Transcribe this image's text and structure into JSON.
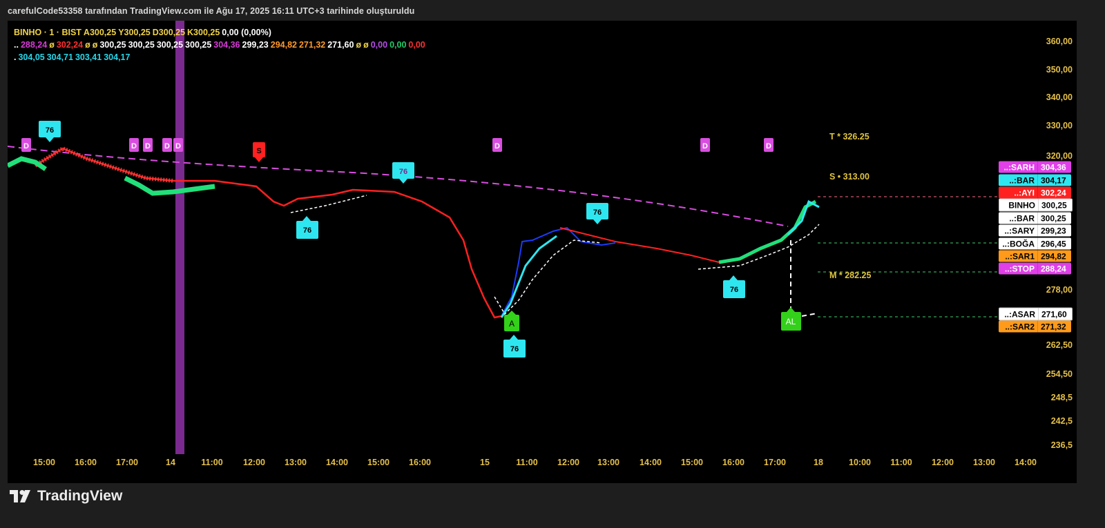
{
  "header": {
    "text": "carefulCode53358 tarafından TradingView.com ile Ağu 17, 2025 16:11 UTC+3 tarihinde oluşturuldu"
  },
  "legend": {
    "row1": [
      {
        "text": "BINHO · 1 · BIST",
        "color": "#f0d349"
      },
      {
        "text": "A300,25",
        "color": "#f0d349"
      },
      {
        "text": "Y300,25",
        "color": "#f0d349"
      },
      {
        "text": "D300,25",
        "color": "#f0d349"
      },
      {
        "text": "K300,25",
        "color": "#f0d349"
      },
      {
        "text": "0,00 (0,00%)",
        "color": "#ffffff"
      }
    ],
    "row2": [
      {
        "text": "..",
        "color": "#ffffff"
      },
      {
        "text": "288,24",
        "color": "#d63bd6"
      },
      {
        "text": "ø",
        "color": "#f0d349"
      },
      {
        "text": "302,24",
        "color": "#ff3030"
      },
      {
        "text": "ø",
        "color": "#f0d349"
      },
      {
        "text": "ø",
        "color": "#f0d349"
      },
      {
        "text": "300,25",
        "color": "#ffffff"
      },
      {
        "text": "300,25",
        "color": "#ffffff"
      },
      {
        "text": "300,25",
        "color": "#ffffff"
      },
      {
        "text": "300,25",
        "color": "#ffffff"
      },
      {
        "text": "304,36",
        "color": "#d63bd6"
      },
      {
        "text": "299,23",
        "color": "#ffffff"
      },
      {
        "text": "294,82",
        "color": "#ff9a2e"
      },
      {
        "text": "271,32",
        "color": "#ff9a2e"
      },
      {
        "text": "271,60",
        "color": "#ffffff"
      },
      {
        "text": "ø",
        "color": "#f0d349"
      },
      {
        "text": "ø",
        "color": "#f0d349"
      },
      {
        "text": "0,00",
        "color": "#b64ee8"
      },
      {
        "text": "0,00",
        "color": "#1fcc6b"
      },
      {
        "text": "0,00",
        "color": "#ff3030"
      }
    ],
    "row3": [
      {
        "text": ".",
        "color": "#ffffff"
      },
      {
        "text": "304,05",
        "color": "#27d6e8"
      },
      {
        "text": "304,71",
        "color": "#27d6e8"
      },
      {
        "text": "303,41",
        "color": "#27d6e8"
      },
      {
        "text": "304,17",
        "color": "#27d6e8"
      }
    ]
  },
  "price_axis": {
    "ticks": [
      "360,00",
      "350,00",
      "340,00",
      "330,00",
      "320,00",
      "278,00",
      "262,50",
      "254,50",
      "248,5",
      "242,5",
      "236,5"
    ]
  },
  "time_axis": {
    "ticks": [
      "15:00",
      "16:00",
      "17:00",
      "14",
      "11:00",
      "12:00",
      "13:00",
      "14:00",
      "15:00",
      "16:00",
      "15",
      "11:00",
      "12:00",
      "13:00",
      "14:00",
      "15:00",
      "16:00",
      "17:00",
      "18",
      "10:00",
      "11:00",
      "12:00",
      "13:00",
      "14:00"
    ]
  },
  "price_badges": [
    {
      "name": "..:SARH",
      "value": "304,36",
      "bg": "#e040e8",
      "fg": "#ffffff"
    },
    {
      "name": "..:BAR",
      "value": "304,17",
      "bg": "#2ee6f0",
      "fg": "#000000"
    },
    {
      "name": "..:AYI",
      "value": "302,24",
      "bg": "#ff2020",
      "fg": "#ffffff"
    },
    {
      "name": "BINHO",
      "value": "300,25",
      "bg": "#ffffff",
      "fg": "#000000"
    },
    {
      "name": "..:BAR",
      "value": "300,25",
      "bg": "#ffffff",
      "fg": "#000000"
    },
    {
      "name": "..:SARY",
      "value": "299,23",
      "bg": "#ffffff",
      "fg": "#000000"
    },
    {
      "name": "..:BOĞA",
      "value": "296,45",
      "bg": "#ffffff",
      "fg": "#000000"
    },
    {
      "name": "..:SAR1",
      "value": "294,82",
      "bg": "#ff9a1a",
      "fg": "#000000"
    },
    {
      "name": "..:STOP",
      "value": "288,24",
      "bg": "#e040e8",
      "fg": "#ffffff"
    },
    {
      "name": "..:ASAR",
      "value": "271,60",
      "bg": "#ffffff",
      "fg": "#000000"
    },
    {
      "name": "..:SAR2",
      "value": "271,32",
      "bg": "#ff9a1a",
      "fg": "#000000"
    }
  ],
  "levels": {
    "t_label": "T * 326.25",
    "s_label": "S • 313.00",
    "m_label": "M * 282.25"
  },
  "markers": {
    "cyan_label": "76",
    "d_label": "D",
    "s_label": "S",
    "a_label": "A",
    "al_label": "AL"
  },
  "colors": {
    "background": "#000000",
    "highlight_band": "#7a2a8e",
    "cyan": "#2ee6f0",
    "magenta": "#d94ee0",
    "red": "#ff2020",
    "green": "#21e07a",
    "blue": "#1a3cff",
    "white": "#ffffff",
    "axis_text": "#e5c04a"
  },
  "footer": {
    "brand": "TradingView",
    "logo": "tradingview-logo-icon"
  }
}
